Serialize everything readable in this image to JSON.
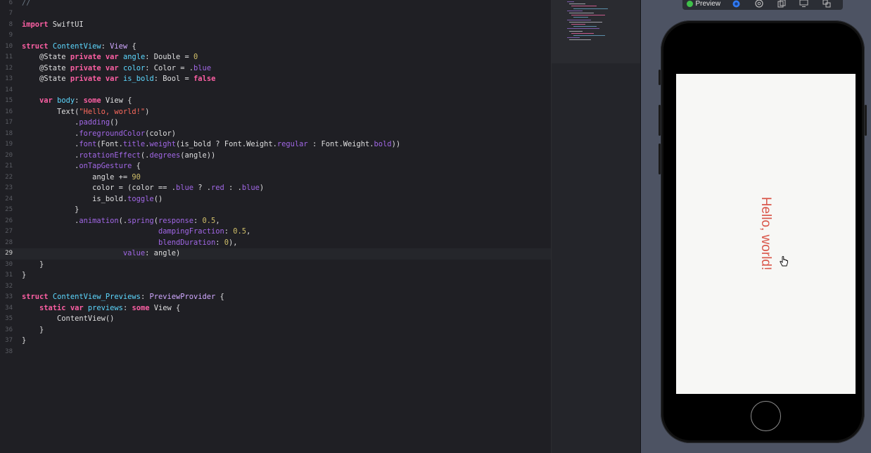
{
  "editor": {
    "current_line": "29",
    "lines": [
      {
        "n": "6",
        "tokens": [
          {
            "t": "//",
            "c": "cm"
          }
        ]
      },
      {
        "n": "7",
        "tokens": []
      },
      {
        "n": "8",
        "tokens": [
          {
            "t": "import",
            "c": "kw"
          },
          {
            "t": " SwiftUI",
            "c": "plain"
          }
        ]
      },
      {
        "n": "9",
        "tokens": []
      },
      {
        "n": "10",
        "tokens": [
          {
            "t": "struct",
            "c": "kw"
          },
          {
            "t": " ",
            "c": "plain"
          },
          {
            "t": "ContentView",
            "c": "tyb"
          },
          {
            "t": ": ",
            "c": "plain"
          },
          {
            "t": "View",
            "c": "ty"
          },
          {
            "t": " {",
            "c": "plain"
          }
        ]
      },
      {
        "n": "11",
        "tokens": [
          {
            "t": "    @State ",
            "c": "plain"
          },
          {
            "t": "private",
            "c": "kw"
          },
          {
            "t": " ",
            "c": "plain"
          },
          {
            "t": "var",
            "c": "kw"
          },
          {
            "t": " ",
            "c": "plain"
          },
          {
            "t": "angle",
            "c": "tyb"
          },
          {
            "t": ": Double = ",
            "c": "plain"
          },
          {
            "t": "0",
            "c": "num"
          }
        ]
      },
      {
        "n": "12",
        "tokens": [
          {
            "t": "    @State ",
            "c": "plain"
          },
          {
            "t": "private",
            "c": "kw"
          },
          {
            "t": " ",
            "c": "plain"
          },
          {
            "t": "var",
            "c": "kw"
          },
          {
            "t": " ",
            "c": "plain"
          },
          {
            "t": "color",
            "c": "tyb"
          },
          {
            "t": ": Color = .",
            "c": "plain"
          },
          {
            "t": "blue",
            "c": "prm"
          }
        ]
      },
      {
        "n": "13",
        "tokens": [
          {
            "t": "    @State ",
            "c": "plain"
          },
          {
            "t": "private",
            "c": "kw"
          },
          {
            "t": " ",
            "c": "plain"
          },
          {
            "t": "var",
            "c": "kw"
          },
          {
            "t": " ",
            "c": "plain"
          },
          {
            "t": "is_bold",
            "c": "tyb"
          },
          {
            "t": ": Bool = ",
            "c": "plain"
          },
          {
            "t": "false",
            "c": "kw"
          }
        ]
      },
      {
        "n": "14",
        "tokens": []
      },
      {
        "n": "15",
        "tokens": [
          {
            "t": "    ",
            "c": "plain"
          },
          {
            "t": "var",
            "c": "kw"
          },
          {
            "t": " ",
            "c": "plain"
          },
          {
            "t": "body",
            "c": "tyb"
          },
          {
            "t": ": ",
            "c": "plain"
          },
          {
            "t": "some",
            "c": "kw"
          },
          {
            "t": " View {",
            "c": "plain"
          }
        ]
      },
      {
        "n": "16",
        "tokens": [
          {
            "t": "        Text(",
            "c": "plain"
          },
          {
            "t": "\"Hello, world!\"",
            "c": "str"
          },
          {
            "t": ")",
            "c": "plain"
          }
        ]
      },
      {
        "n": "17",
        "tokens": [
          {
            "t": "            .",
            "c": "plain"
          },
          {
            "t": "padding",
            "c": "fn"
          },
          {
            "t": "()",
            "c": "plain"
          }
        ]
      },
      {
        "n": "18",
        "tokens": [
          {
            "t": "            .",
            "c": "plain"
          },
          {
            "t": "foregroundColor",
            "c": "fn"
          },
          {
            "t": "(color)",
            "c": "plain"
          }
        ]
      },
      {
        "n": "19",
        "tokens": [
          {
            "t": "            .",
            "c": "plain"
          },
          {
            "t": "font",
            "c": "fn"
          },
          {
            "t": "(Font.",
            "c": "plain"
          },
          {
            "t": "title",
            "c": "prm"
          },
          {
            "t": ".",
            "c": "plain"
          },
          {
            "t": "weight",
            "c": "fn"
          },
          {
            "t": "(is_bold ? Font.Weight.",
            "c": "plain"
          },
          {
            "t": "regular",
            "c": "prm"
          },
          {
            "t": " : Font.Weight.",
            "c": "plain"
          },
          {
            "t": "bold",
            "c": "prm"
          },
          {
            "t": "))",
            "c": "plain"
          }
        ]
      },
      {
        "n": "20",
        "tokens": [
          {
            "t": "            .",
            "c": "plain"
          },
          {
            "t": "rotationEffect",
            "c": "fn"
          },
          {
            "t": "(.",
            "c": "plain"
          },
          {
            "t": "degrees",
            "c": "fn"
          },
          {
            "t": "(angle))",
            "c": "plain"
          }
        ]
      },
      {
        "n": "21",
        "tokens": [
          {
            "t": "            .",
            "c": "plain"
          },
          {
            "t": "onTapGesture",
            "c": "fn"
          },
          {
            "t": " {",
            "c": "plain"
          }
        ]
      },
      {
        "n": "22",
        "tokens": [
          {
            "t": "                angle += ",
            "c": "plain"
          },
          {
            "t": "90",
            "c": "num"
          }
        ]
      },
      {
        "n": "23",
        "tokens": [
          {
            "t": "                color = (color == .",
            "c": "plain"
          },
          {
            "t": "blue",
            "c": "prm"
          },
          {
            "t": " ? .",
            "c": "plain"
          },
          {
            "t": "red",
            "c": "prm"
          },
          {
            "t": " : .",
            "c": "plain"
          },
          {
            "t": "blue",
            "c": "prm"
          },
          {
            "t": ")",
            "c": "plain"
          }
        ]
      },
      {
        "n": "24",
        "tokens": [
          {
            "t": "                is_bold.",
            "c": "plain"
          },
          {
            "t": "toggle",
            "c": "fn"
          },
          {
            "t": "()",
            "c": "plain"
          }
        ]
      },
      {
        "n": "25",
        "tokens": [
          {
            "t": "            }",
            "c": "plain"
          }
        ]
      },
      {
        "n": "26",
        "tokens": [
          {
            "t": "            .",
            "c": "plain"
          },
          {
            "t": "animation",
            "c": "fn"
          },
          {
            "t": "(.",
            "c": "plain"
          },
          {
            "t": "spring",
            "c": "fn"
          },
          {
            "t": "(",
            "c": "plain"
          },
          {
            "t": "response",
            "c": "fn"
          },
          {
            "t": ": ",
            "c": "plain"
          },
          {
            "t": "0.5",
            "c": "num"
          },
          {
            "t": ",",
            "c": "plain"
          }
        ]
      },
      {
        "n": "27",
        "tokens": [
          {
            "t": "                               ",
            "c": "plain"
          },
          {
            "t": "dampingFraction",
            "c": "fn"
          },
          {
            "t": ": ",
            "c": "plain"
          },
          {
            "t": "0.5",
            "c": "num"
          },
          {
            "t": ",",
            "c": "plain"
          }
        ]
      },
      {
        "n": "28",
        "tokens": [
          {
            "t": "                               ",
            "c": "plain"
          },
          {
            "t": "blendDuration",
            "c": "fn"
          },
          {
            "t": ": ",
            "c": "plain"
          },
          {
            "t": "0",
            "c": "num"
          },
          {
            "t": "),",
            "c": "plain"
          }
        ]
      },
      {
        "n": "29",
        "tokens": [
          {
            "t": "                       ",
            "c": "plain"
          },
          {
            "t": "value",
            "c": "fn"
          },
          {
            "t": ": angle)",
            "c": "plain"
          }
        ]
      },
      {
        "n": "30",
        "tokens": [
          {
            "t": "    }",
            "c": "plain"
          }
        ]
      },
      {
        "n": "31",
        "tokens": [
          {
            "t": "}",
            "c": "plain"
          }
        ]
      },
      {
        "n": "32",
        "tokens": []
      },
      {
        "n": "33",
        "tokens": [
          {
            "t": "struct",
            "c": "kw"
          },
          {
            "t": " ",
            "c": "plain"
          },
          {
            "t": "ContentView_Previews",
            "c": "tyb"
          },
          {
            "t": ": ",
            "c": "plain"
          },
          {
            "t": "PreviewProvider",
            "c": "ty"
          },
          {
            "t": " {",
            "c": "plain"
          }
        ]
      },
      {
        "n": "34",
        "tokens": [
          {
            "t": "    ",
            "c": "plain"
          },
          {
            "t": "static",
            "c": "kw"
          },
          {
            "t": " ",
            "c": "plain"
          },
          {
            "t": "var",
            "c": "kw"
          },
          {
            "t": " ",
            "c": "plain"
          },
          {
            "t": "previews",
            "c": "tyb"
          },
          {
            "t": ": ",
            "c": "plain"
          },
          {
            "t": "some",
            "c": "kw"
          },
          {
            "t": " View {",
            "c": "plain"
          }
        ]
      },
      {
        "n": "35",
        "tokens": [
          {
            "t": "        ContentView()",
            "c": "plain"
          }
        ]
      },
      {
        "n": "36",
        "tokens": [
          {
            "t": "    }",
            "c": "plain"
          }
        ]
      },
      {
        "n": "37",
        "tokens": [
          {
            "t": "}",
            "c": "plain"
          }
        ]
      },
      {
        "n": "38",
        "tokens": []
      }
    ]
  },
  "preview": {
    "toolbar_label": "Preview",
    "icons": [
      "live-preview-icon",
      "inspect-icon",
      "duplicate-icon",
      "device-icon",
      "variants-icon"
    ],
    "device_text": "Hello, world!",
    "text_color": "#d9564a",
    "accent_blue": "#2f7bf5",
    "status_green": "#3fc04a"
  }
}
